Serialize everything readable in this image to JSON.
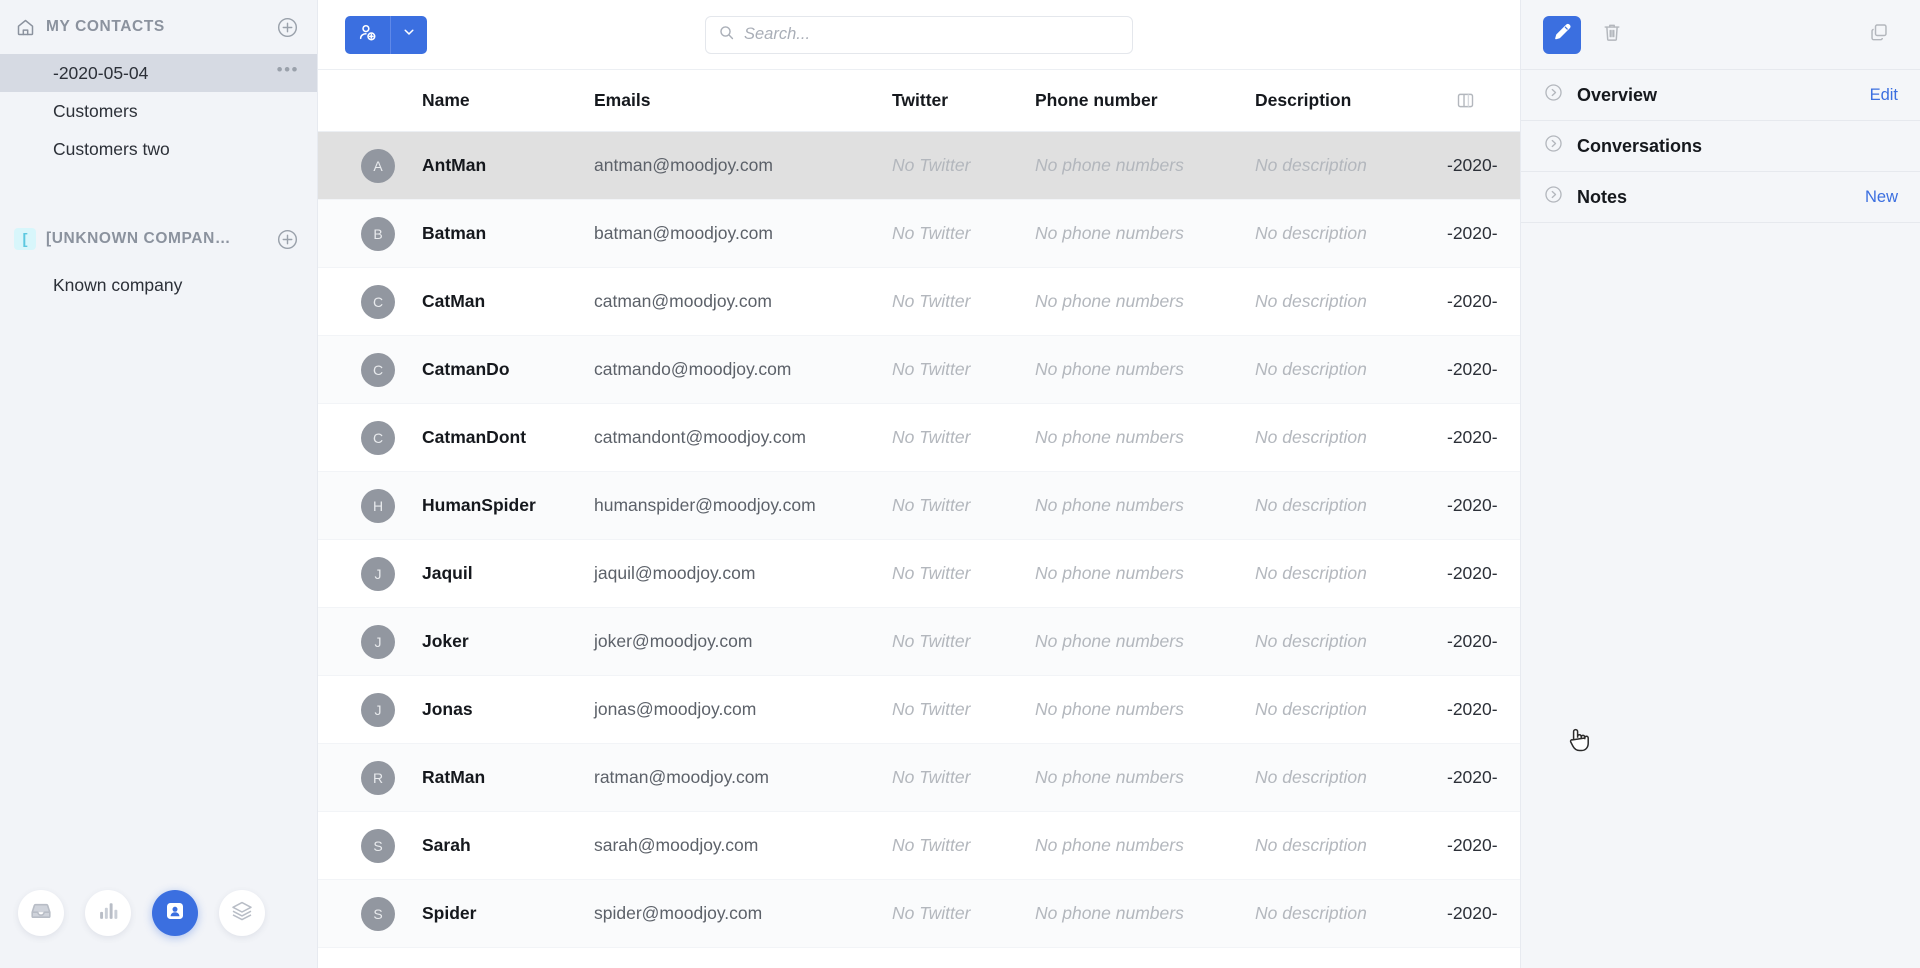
{
  "sidebar": {
    "groups": [
      {
        "icon": "home-icon",
        "label": "MY CONTACTS",
        "add_label": "+",
        "items": [
          {
            "label": "-2020-05-04",
            "selected": true,
            "more": "•••"
          },
          {
            "label": "Customers",
            "selected": false,
            "more": ""
          },
          {
            "label": "Customers two",
            "selected": false,
            "more": ""
          }
        ]
      },
      {
        "icon": "bracket-icon",
        "icon_glyph": "[",
        "label": "[UNKNOWN COMPAN…",
        "add_label": "+",
        "items": [
          {
            "label": "Known company",
            "selected": false,
            "more": ""
          }
        ]
      }
    ],
    "bottom_nav": [
      {
        "name": "inbox-icon",
        "active": false
      },
      {
        "name": "reports-bar-chart-icon",
        "active": false
      },
      {
        "name": "contacts-card-icon",
        "active": true
      },
      {
        "name": "layers-icon",
        "active": false
      }
    ]
  },
  "toolbar": {
    "add_contact_label": "add-contact",
    "add_contact_caret": "chevron-down-icon",
    "search": {
      "placeholder": "Search...",
      "value": ""
    }
  },
  "table": {
    "columns": [
      "Name",
      "Emails",
      "Twitter",
      "Phone number",
      "Description"
    ],
    "column_toggle_icon": "column-layout-icon",
    "placeholders": {
      "twitter": "No Twitter",
      "phone": "No phone numbers",
      "description": "No description"
    },
    "date_truncated": "-2020-",
    "rows": [
      {
        "initial": "A",
        "name": "AntMan",
        "email": "antman@moodjoy.com",
        "twitter": "No Twitter",
        "phone": "No phone numbers",
        "description": "No description",
        "date": "-2020-",
        "selected": true
      },
      {
        "initial": "B",
        "name": "Batman",
        "email": "batman@moodjoy.com",
        "twitter": "No Twitter",
        "phone": "No phone numbers",
        "description": "No description",
        "date": "-2020-",
        "selected": false
      },
      {
        "initial": "C",
        "name": "CatMan",
        "email": "catman@moodjoy.com",
        "twitter": "No Twitter",
        "phone": "No phone numbers",
        "description": "No description",
        "date": "-2020-",
        "selected": false
      },
      {
        "initial": "C",
        "name": "CatmanDo",
        "email": "catmando@moodjoy.com",
        "twitter": "No Twitter",
        "phone": "No phone numbers",
        "description": "No description",
        "date": "-2020-",
        "selected": false
      },
      {
        "initial": "C",
        "name": "CatmanDont",
        "email": "catmandont@moodjoy.com",
        "twitter": "No Twitter",
        "phone": "No phone numbers",
        "description": "No description",
        "date": "-2020-",
        "selected": false
      },
      {
        "initial": "H",
        "name": "HumanSpider",
        "email": "humanspider@moodjoy.com",
        "twitter": "No Twitter",
        "phone": "No phone numbers",
        "description": "No description",
        "date": "-2020-",
        "selected": false
      },
      {
        "initial": "J",
        "name": "Jaquil",
        "email": "jaquil@moodjoy.com",
        "twitter": "No Twitter",
        "phone": "No phone numbers",
        "description": "No description",
        "date": "-2020-",
        "selected": false
      },
      {
        "initial": "J",
        "name": "Joker",
        "email": "joker@moodjoy.com",
        "twitter": "No Twitter",
        "phone": "No phone numbers",
        "description": "No description",
        "date": "-2020-",
        "selected": false
      },
      {
        "initial": "J",
        "name": "Jonas",
        "email": "jonas@moodjoy.com",
        "twitter": "No Twitter",
        "phone": "No phone numbers",
        "description": "No description",
        "date": "-2020-",
        "selected": false
      },
      {
        "initial": "R",
        "name": "RatMan",
        "email": "ratman@moodjoy.com",
        "twitter": "No Twitter",
        "phone": "No phone numbers",
        "description": "No description",
        "date": "-2020-",
        "selected": false
      },
      {
        "initial": "S",
        "name": "Sarah",
        "email": "sarah@moodjoy.com",
        "twitter": "No Twitter",
        "phone": "No phone numbers",
        "description": "No description",
        "date": "-2020-",
        "selected": false
      },
      {
        "initial": "S",
        "name": "Spider",
        "email": "spider@moodjoy.com",
        "twitter": "No Twitter",
        "phone": "No phone numbers",
        "description": "No description",
        "date": "-2020-",
        "selected": false
      }
    ]
  },
  "right_panel": {
    "actions": [
      {
        "name": "edit-pencil-icon",
        "primary": true
      },
      {
        "name": "delete-trash-icon",
        "primary": false
      },
      {
        "name": "duplicate-copy-icon",
        "primary": false
      }
    ],
    "sections": [
      {
        "label": "Overview",
        "action": "Edit"
      },
      {
        "label": "Conversations",
        "action": ""
      },
      {
        "label": "Notes",
        "action": "New"
      }
    ]
  },
  "colors": {
    "accent": "#3b6fe0",
    "sidebar_bg": "#f2f4f8",
    "selected_row": "#e0e0e0",
    "muted_text": "#b3b7bd",
    "bracket_badge": "#d8f6fb"
  }
}
